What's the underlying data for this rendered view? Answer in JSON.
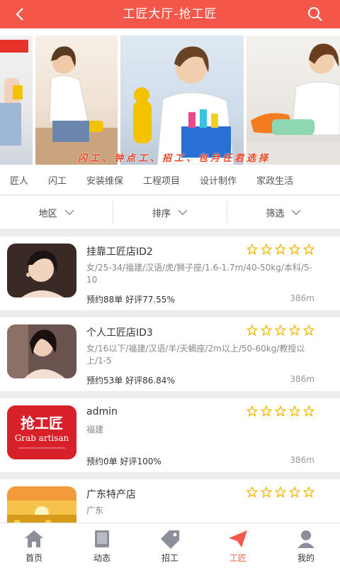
{
  "header": {
    "title": "工匠大厅-抢工匠"
  },
  "banner": {
    "caption": "闪工、钟点工、招工、包月任君选择"
  },
  "categories": [
    "匠人",
    "闪工",
    "安装维保",
    "工程项目",
    "设计制作",
    "家政生活"
  ],
  "filters": [
    "地区",
    "排序",
    "筛选"
  ],
  "items": [
    {
      "name": "挂靠工匠店ID2",
      "detail": "女/25-34/福建/汉语/虎/狮子座/1.6-1.7m/40-50kg/本科/5-10",
      "stats": "预约88单 好评77.55%",
      "distance": "386m",
      "stars": 5
    },
    {
      "name": "个人工匠店ID3",
      "detail": "女/16以下/福建/汉语/羊/天蝎座/2m以上/50-60kg/教授以上/1-5",
      "stats": "预约53单 好评86.84%",
      "distance": "386m",
      "stars": 5
    },
    {
      "name": "admin",
      "detail": "福建",
      "stats": "预约0单 好评100%",
      "distance": "386m",
      "stars": 5,
      "logo_text": "抢工匠",
      "logo_sub": "Grab artisan"
    },
    {
      "name": "广东特产店",
      "detail": "广东",
      "stats": "",
      "distance": "",
      "stars": 5
    }
  ],
  "nav": [
    {
      "label": "首页",
      "icon": "home-icon"
    },
    {
      "label": "动态",
      "icon": "book-icon"
    },
    {
      "label": "招工",
      "icon": "tag-icon"
    },
    {
      "label": "工匠",
      "icon": "paper-plane-icon",
      "active": true
    },
    {
      "label": "我的",
      "icon": "user-icon"
    }
  ],
  "colors": {
    "brand": "#f4574a",
    "star": "#f5b800"
  }
}
